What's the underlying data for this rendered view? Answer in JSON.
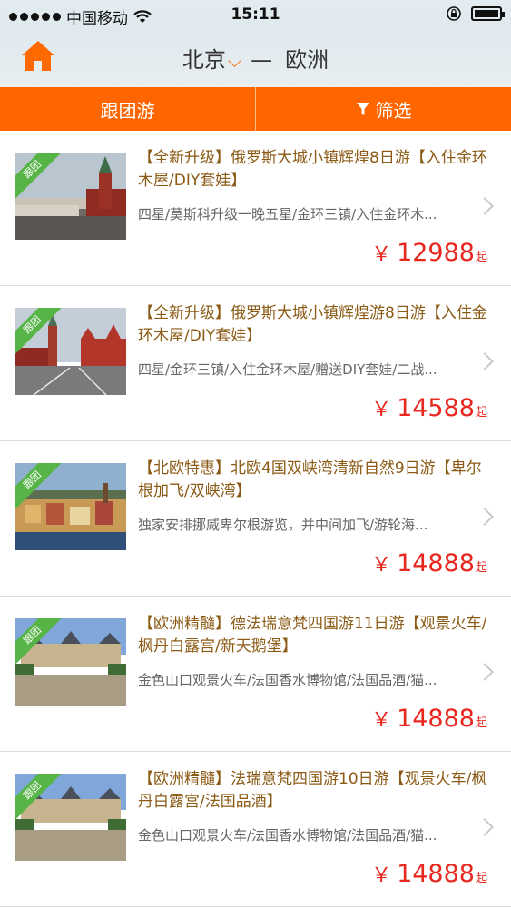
{
  "status_bar": {
    "carrier": "中国移动",
    "time": "15:11"
  },
  "header": {
    "from_city": "北京",
    "to_region": "欧洲",
    "separator": "—"
  },
  "tabs": {
    "group_tour": "跟团游",
    "filter": "筛选"
  },
  "ribbon_label": "跟团",
  "products": [
    {
      "title": "【全新升级】俄罗斯大城小镇辉煌8日游【入住金环木屋/DIY套娃】",
      "desc": "四星/莫斯科升级一晚五星/金环三镇/入住金环木...",
      "currency": "￥",
      "price": "12988",
      "suffix": "起"
    },
    {
      "title": "【全新升级】俄罗斯大城小镇辉煌游8日游【入住金环木屋/DIY套娃】",
      "desc": "四星/金环三镇/入住金环木屋/赠送DIY套娃/二战...",
      "currency": "￥",
      "price": "14588",
      "suffix": "起"
    },
    {
      "title": "【北欧特惠】北欧4国双峡湾清新自然9日游【卑尔根加飞/双峡湾】",
      "desc": "独家安排挪威卑尔根游览，并中间加飞/游轮海...",
      "currency": "￥",
      "price": "14888",
      "suffix": "起"
    },
    {
      "title": "【欧洲精髓】德法瑞意梵四国游11日游【观景火车/枫丹白露宫/新天鹅堡】",
      "desc": "金色山口观景火车/法国香水博物馆/法国品酒/猫...",
      "currency": "￥",
      "price": "14888",
      "suffix": "起"
    },
    {
      "title": "【欧洲精髓】法瑞意梵四国游10日游【观景火车/枫丹白露宫/法国品酒】",
      "desc": "金色山口观景火车/法国香水博物馆/法国品酒/猫...",
      "currency": "￥",
      "price": "14888",
      "suffix": "起"
    }
  ],
  "colors": {
    "accent": "#ff6600",
    "price": "#e8271f",
    "title": "#8b5a14",
    "ribbon": "#57b447"
  }
}
